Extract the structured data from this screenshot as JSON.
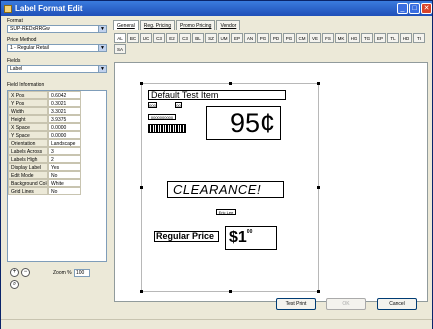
{
  "window": {
    "title": "Label Format Edit"
  },
  "left": {
    "format_label": "Format",
    "format_value": "SUP-REDxRRGw",
    "price_method_label": "Price Method",
    "price_method_value": "1 - Regular Retail",
    "fields_label": "Fields",
    "fields_value": "Label",
    "field_info_label": "Field Information",
    "properties": [
      {
        "key": "X Pos",
        "value": "0.6042"
      },
      {
        "key": "Y Pos",
        "value": "0.3021"
      },
      {
        "key": "Width",
        "value": "3.3021"
      },
      {
        "key": "Height",
        "value": "3.9375"
      },
      {
        "key": "X Space",
        "value": "0.0000"
      },
      {
        "key": "Y Space",
        "value": "0.0000"
      },
      {
        "key": "Orientation",
        "value": "Landscape"
      },
      {
        "key": "Labels Across",
        "value": "3"
      },
      {
        "key": "Labels High",
        "value": "2"
      },
      {
        "key": "Display Label",
        "value": "Yes"
      },
      {
        "key": "Edit Mode",
        "value": "No"
      },
      {
        "key": "Background Color",
        "value": "White"
      },
      {
        "key": "Grid Lines",
        "value": "No"
      }
    ],
    "zoom_label": "Zoom %",
    "zoom_value": "100"
  },
  "tabs": [
    "General",
    "Reg. Pricing",
    "Promo Pricing",
    "Vendor"
  ],
  "subtabs_row1": [
    "AL",
    "BC",
    "UC",
    "C3",
    "E2",
    "C3",
    "BL",
    "SZ",
    "UM",
    "EP",
    "AN",
    "PG",
    "PD",
    "PG",
    "CM",
    "VE",
    "FS",
    "MK",
    "HG",
    "TG",
    "EP",
    "TL",
    "HD",
    "TI"
  ],
  "subtabs_row2": [
    "SA"
  ],
  "label": {
    "title": "Default Test Item",
    "small_box_1": "000",
    "small_box_2": "00",
    "small_code": "0000000000",
    "price": "95¢",
    "clearance": "CLEARANCE!",
    "small_label": "Eric Lee",
    "regular_price_label": "Regular Price",
    "dollar_value": "$1",
    "dollar_cents": "00"
  },
  "buttons": {
    "test_print": "Test Print",
    "ok": "OK",
    "cancel": "Cancel"
  }
}
